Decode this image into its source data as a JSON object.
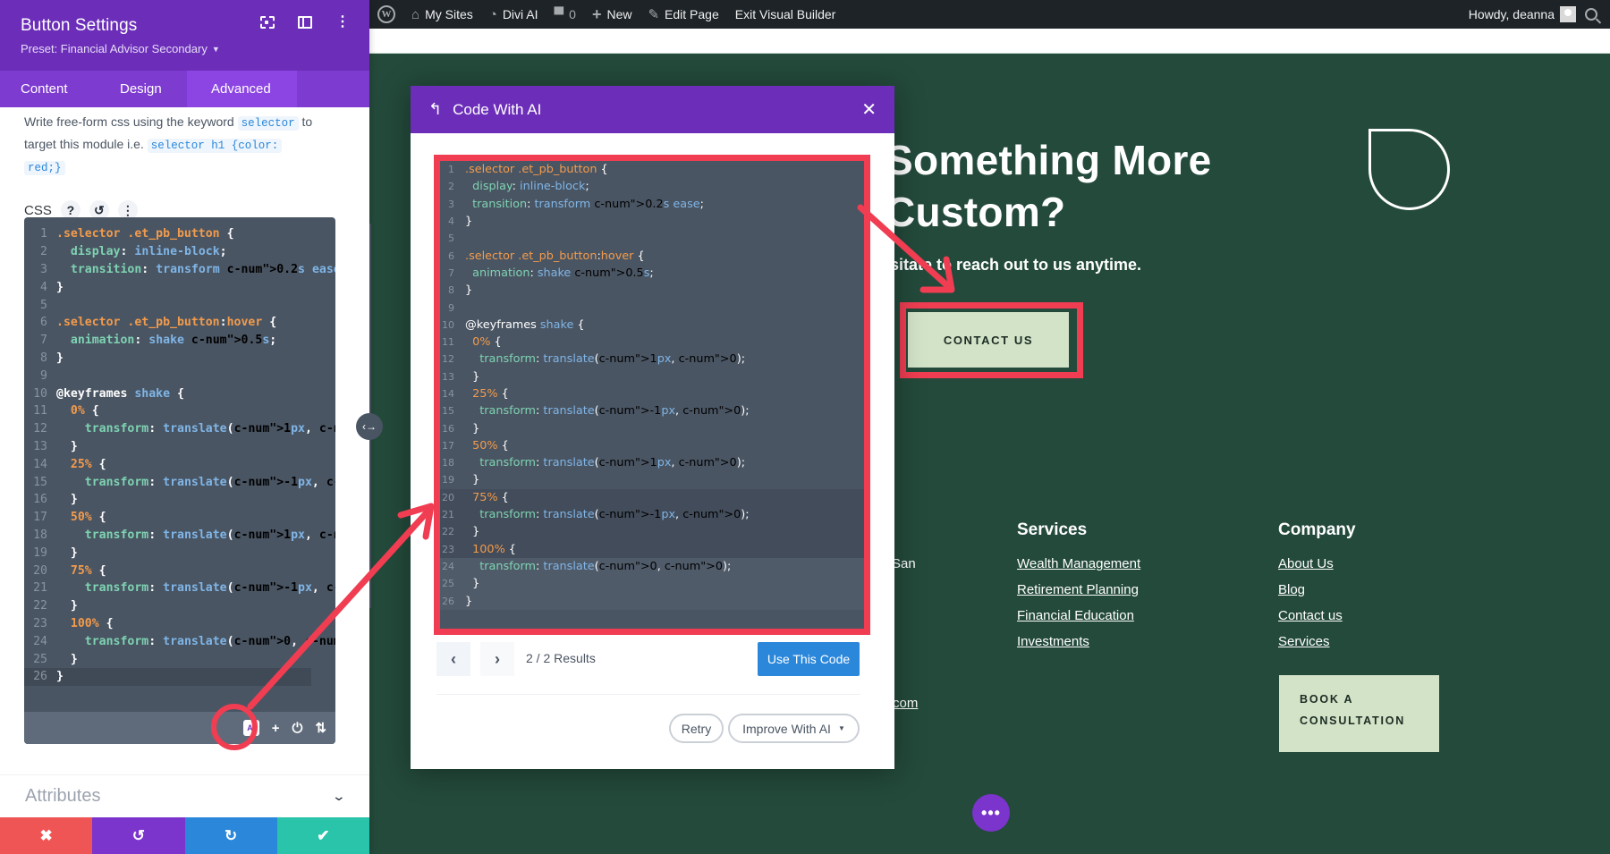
{
  "admin_bar": {
    "items": [
      {
        "icon": "wordpress-logo-icon",
        "label": ""
      },
      {
        "icon": "my-sites-icon",
        "label": "My Sites"
      },
      {
        "icon": "divi-ai-icon",
        "label": "Divi AI"
      },
      {
        "icon": "comment-icon",
        "label": "0"
      },
      {
        "icon": "plus-icon",
        "label": "New"
      },
      {
        "icon": "pencil-icon",
        "label": "Edit Page"
      },
      {
        "icon": "",
        "label": "Exit Visual Builder"
      }
    ],
    "greeting": "Howdy, deanna"
  },
  "settings_panel": {
    "title": "Button Settings",
    "preset": "Preset: Financial Advisor Secondary",
    "tabs": [
      {
        "label": "Content",
        "active": false
      },
      {
        "label": "Design",
        "active": false
      },
      {
        "label": "Advanced",
        "active": true
      }
    ],
    "description_parts": [
      "Write free-form css using the keyword",
      "selector",
      "to target this module i.e.",
      "selector h1 {color:",
      "red;}"
    ],
    "css_label": "CSS",
    "help_icon": "?",
    "toolbar": {
      "ai_label": "AI"
    },
    "attributes_label": "Attributes",
    "footer": {
      "close": "✖",
      "undo": "↺",
      "redo": "↻",
      "save": "✔"
    }
  },
  "css_code": [
    ".selector .et_pb_button {",
    "  display: inline-block;",
    "  transition: transform 0.2s ease;",
    "}",
    "",
    ".selector .et_pb_button:hover {",
    "  animation: shake 0.5s;",
    "}",
    "",
    "@keyframes shake {",
    "  0% {",
    "    transform: translate(1px, 0);",
    "  }",
    "  25% {",
    "    transform: translate(-1px, 0);",
    "  }",
    "  50% {",
    "    transform: translate(1px, 0);",
    "  }",
    "  75% {",
    "    transform: translate(-1px, 0);",
    "  }",
    "  100% {",
    "    transform: translate(0, 0);",
    "  }",
    "}"
  ],
  "modal": {
    "title": "Code With AI",
    "results": "2 / 2 Results",
    "use_button": "Use This Code",
    "retry_button": "Retry",
    "improve_button": "Improve With AI"
  },
  "page": {
    "hero_title_line1": "Something More",
    "hero_title_line2": "Custom?",
    "hero_sub": "sitate to reach out to us anytime.",
    "contact_button": "CONTACT US",
    "fragments": [
      ":",
      "San",
      "!",
      ":",
      ":",
      "com"
    ],
    "services": {
      "heading": "Services",
      "links": [
        "Wealth Management",
        "Retirement Planning",
        "Financial Education",
        "Investments"
      ]
    },
    "company": {
      "heading": "Company",
      "links": [
        "About Us",
        "Blog",
        "Contact us",
        "Services"
      ]
    },
    "book_button_line1": "BOOK A",
    "book_button_line2": "CONSULTATION"
  },
  "colors": {
    "divi_purple": "#6c2eb9",
    "tab_purple": "#7e3bd0",
    "page_green": "#234a3b",
    "highlight_red": "#f03d52",
    "button_blue": "#2b87da",
    "mint": "#d2e3c8"
  }
}
